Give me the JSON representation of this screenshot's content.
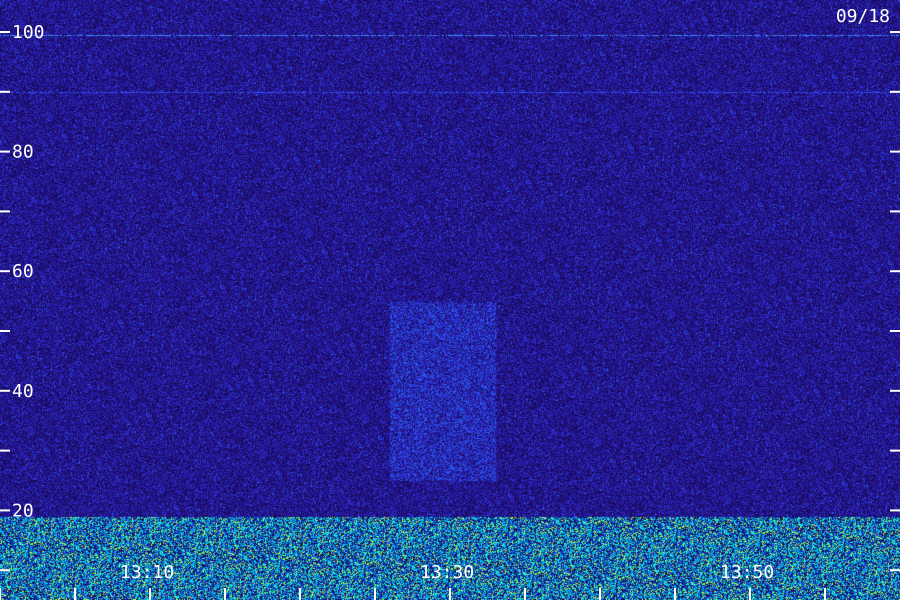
{
  "chart_data": {
    "type": "heatmap",
    "title": "",
    "date": "09/18",
    "xlabel": "",
    "ylabel": "",
    "ylim": [
      0,
      105
    ],
    "y_ticks": [
      10,
      20,
      30,
      40,
      50,
      60,
      70,
      80,
      90,
      100
    ],
    "y_tick_labels": [
      "",
      "20",
      "",
      "40",
      "",
      "60",
      "",
      "80",
      "",
      "100"
    ],
    "x_minutes_range": [
      "13:00",
      "13:59"
    ],
    "x_ticks": [
      "13:00",
      "13:05",
      "13:10",
      "13:15",
      "13:20",
      "13:25",
      "13:30",
      "13:35",
      "13:40",
      "13:45",
      "13:50",
      "13:55"
    ],
    "x_tick_labels": [
      "",
      "",
      "13:10",
      "",
      "",
      "",
      "13:30",
      "",
      "",
      "",
      "13:50",
      ""
    ],
    "colors": {
      "background": "#22106a",
      "low": "#1a0a5a",
      "mid": "#2a3ad8",
      "high": "#00c8e6",
      "peak": "#b4ff3c",
      "labels": "#ffffff"
    },
    "features": [
      {
        "kind": "horizontal_line",
        "y": 99.5,
        "intensity": "high"
      },
      {
        "kind": "horizontal_line",
        "y": 90,
        "intensity": "mid"
      },
      {
        "kind": "noise_band",
        "y_range": [
          0,
          19
        ],
        "intensity": "high"
      },
      {
        "kind": "faint_patch",
        "x_range": [
          "13:26",
          "13:33"
        ],
        "y_range": [
          25,
          55
        ],
        "intensity": "mid"
      }
    ]
  }
}
